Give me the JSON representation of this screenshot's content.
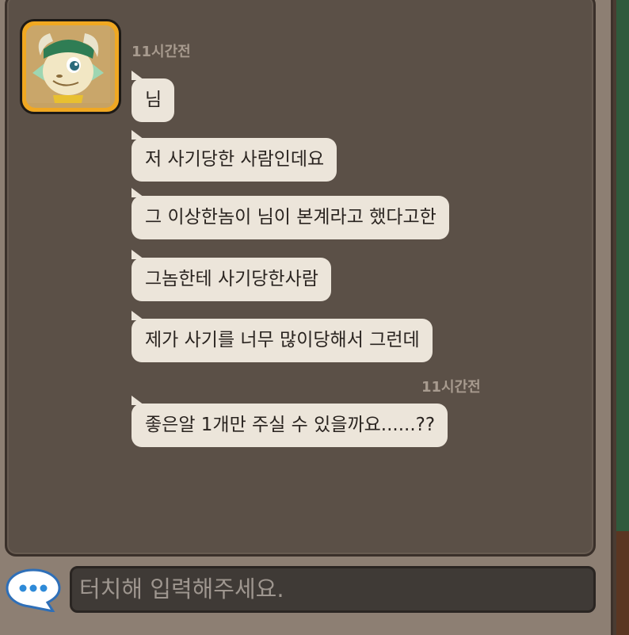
{
  "messages": [
    {
      "time": "11시간전",
      "lines": [
        "님",
        "저 사기당한 사람인데요",
        "그 이상한놈이 님이 본계라고 했다고한",
        "그놈한테 사기당한사람",
        "제가 사기를 너무 많이당해서 그런데"
      ]
    },
    {
      "time": "11시간전",
      "lines": [
        "좋은알 1개만 주실 수 있을까요......??"
      ]
    }
  ],
  "input": {
    "placeholder": "터치해 입력해주세요."
  },
  "icons": {
    "avatar": "dragon-avatar-icon",
    "chat": "speech-bubble-icon"
  },
  "colors": {
    "panel": "#5b5047",
    "bubble": "#ece5da",
    "avatar_frame": "#f0a822",
    "timestamp": "#a89b8f"
  }
}
